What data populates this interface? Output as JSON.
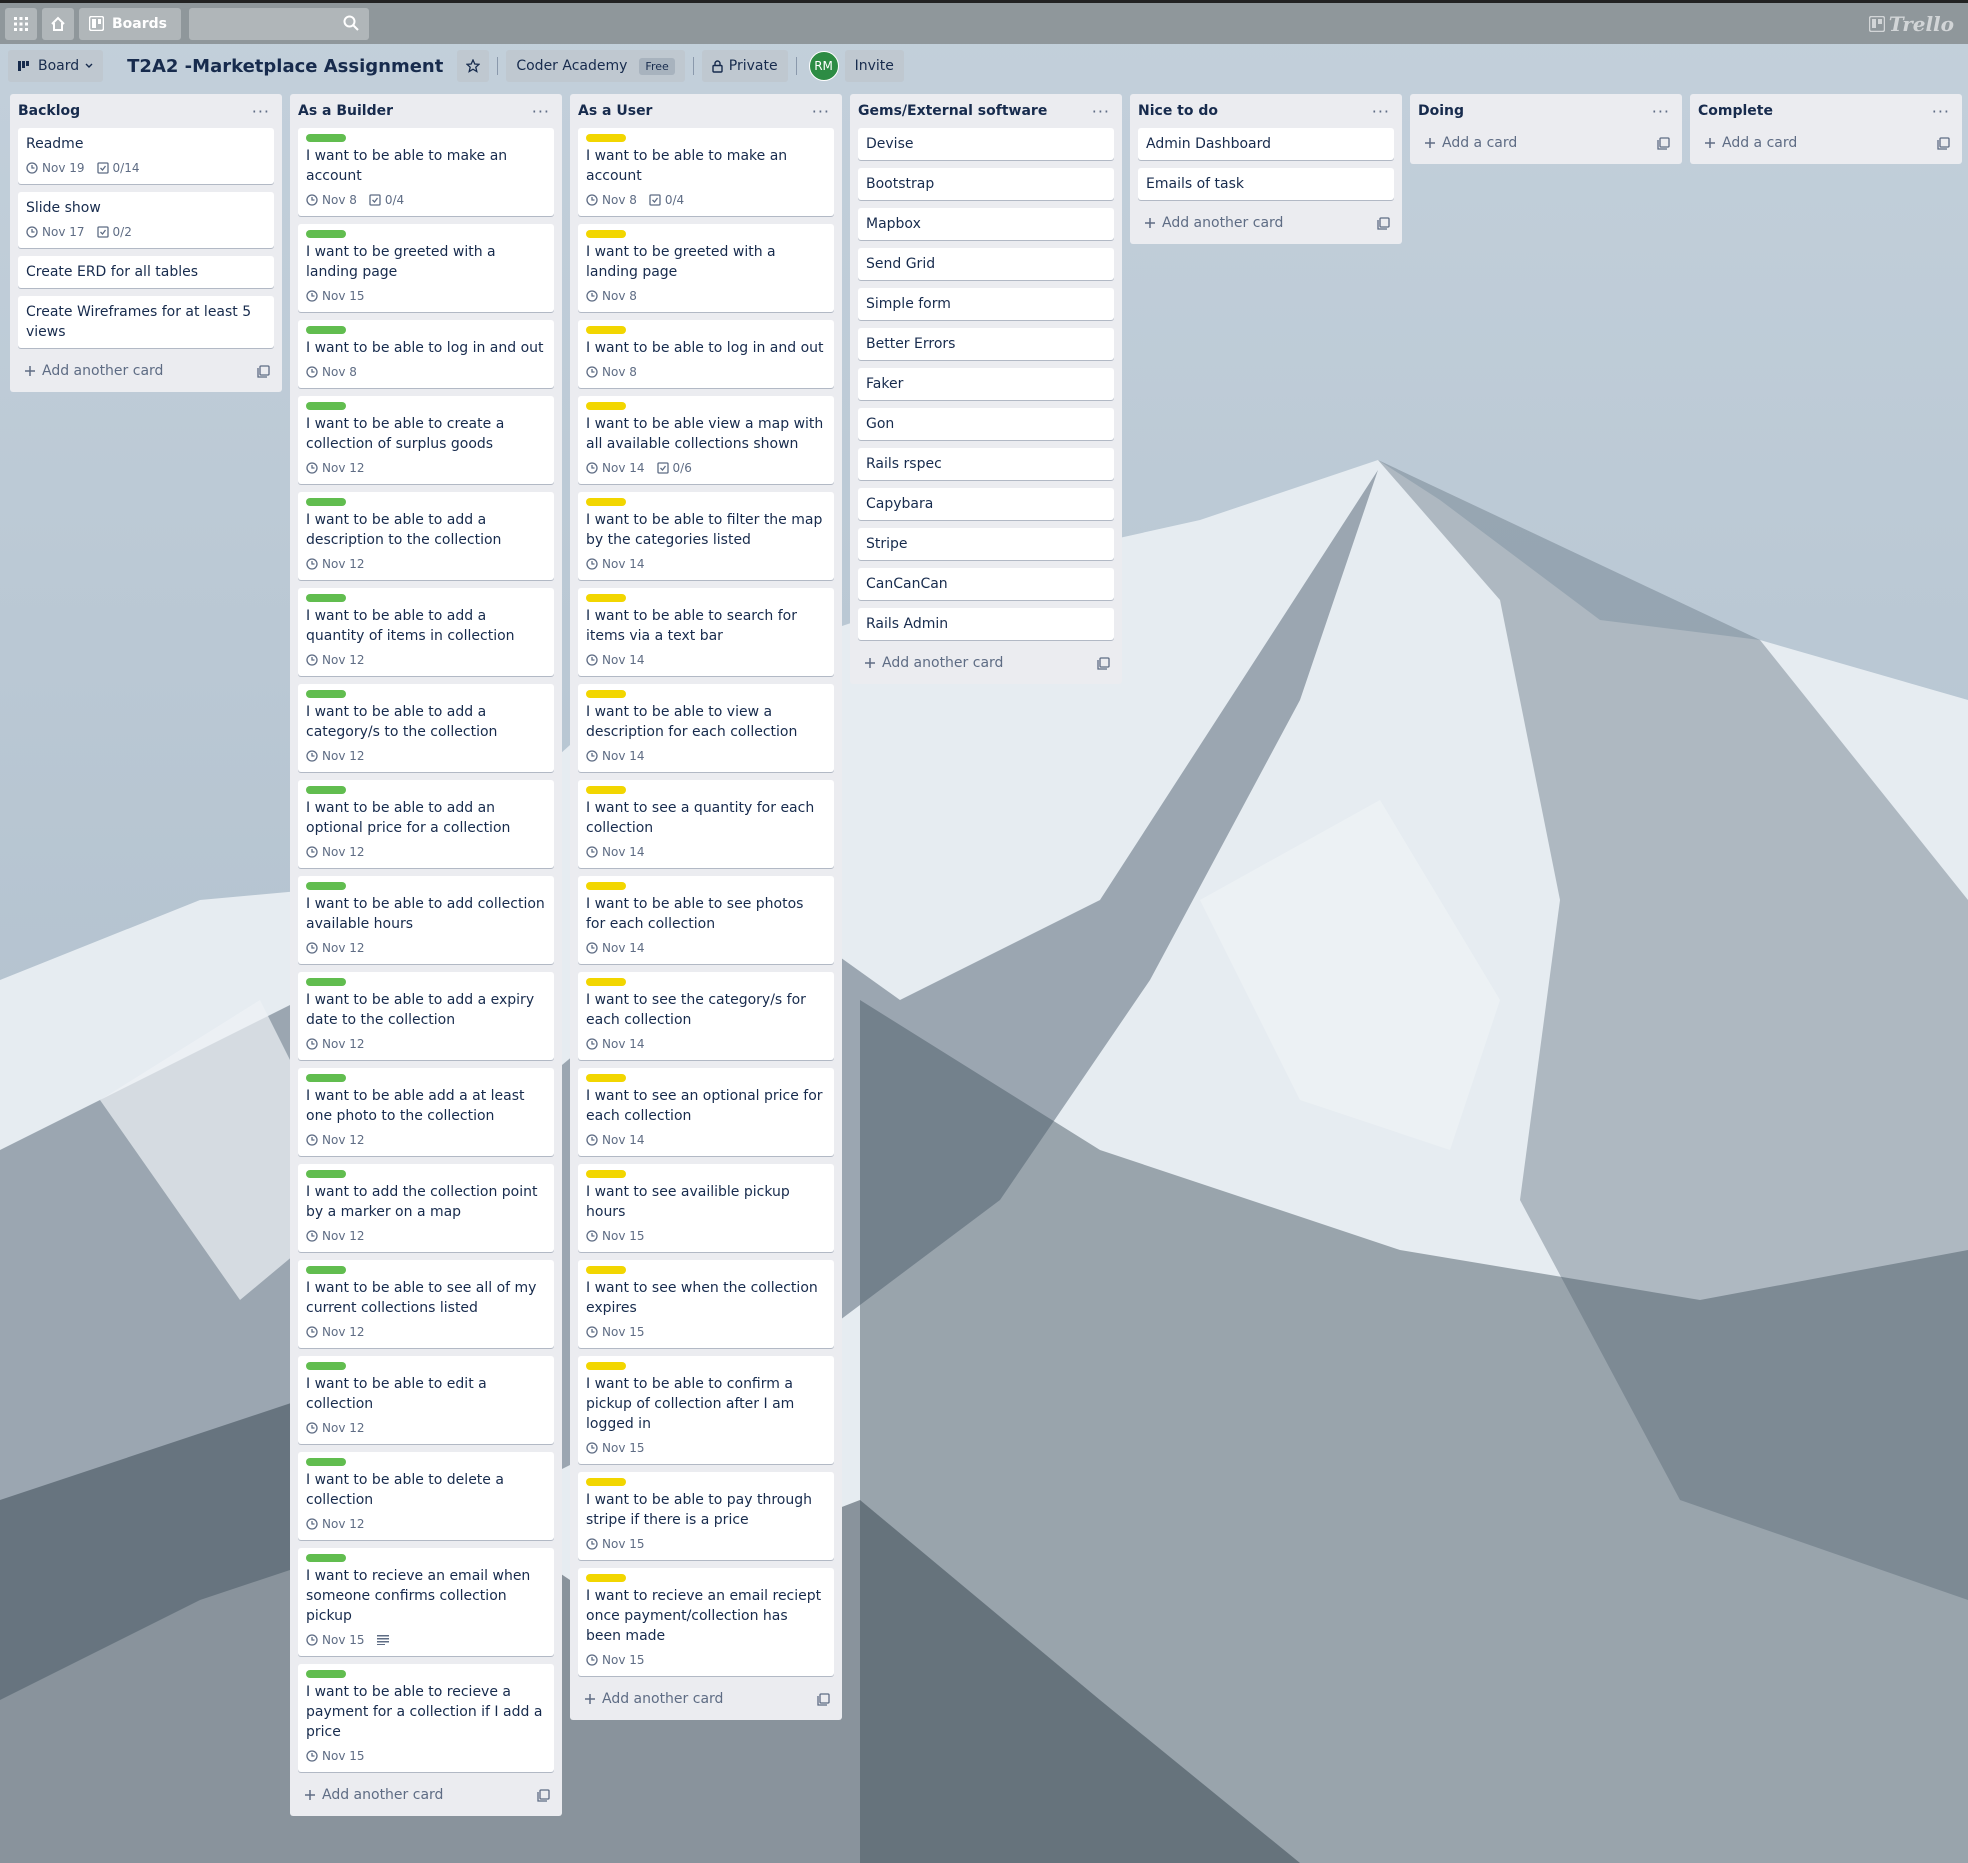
{
  "topbar": {
    "boards_label": "Boards",
    "logo": "Trello"
  },
  "board": {
    "view_label": "Board",
    "title": "T2A2 -Marketplace Assignment",
    "team": "Coder Academy",
    "plan": "Free",
    "visibility": "Private",
    "member_initials": "RM",
    "invite_label": "Invite"
  },
  "lists": [
    {
      "title": "Backlog",
      "add_label": "Add another card",
      "cards": [
        {
          "text": "Readme",
          "due": "Nov 19",
          "checklist": "0/14"
        },
        {
          "text": "Slide show",
          "due": "Nov 17",
          "checklist": "0/2"
        },
        {
          "text": "Create ERD for all tables"
        },
        {
          "text": "Create Wireframes for at least 5 views"
        }
      ]
    },
    {
      "title": "As a Builder",
      "add_label": "Add another card",
      "label_color": "green",
      "cards": [
        {
          "text": "I want to be able to make an account",
          "due": "Nov 8",
          "checklist": "0/4"
        },
        {
          "text": "I want to be greeted with a landing page",
          "due": "Nov 15"
        },
        {
          "text": "I want to be able to log in and out",
          "due": "Nov 8"
        },
        {
          "text": "I want to be able to create a collection of surplus goods",
          "due": "Nov 12"
        },
        {
          "text": "I want to be able to add a description to the collection",
          "due": "Nov 12"
        },
        {
          "text": "I want to be able to add a quantity of items in collection",
          "due": "Nov 12"
        },
        {
          "text": "I want to be able to add a category/s to the collection",
          "due": "Nov 12"
        },
        {
          "text": "I want to be able to add an optional price for a collection",
          "due": "Nov 12"
        },
        {
          "text": "I want to be able to add collection available hours",
          "due": "Nov 12"
        },
        {
          "text": "I want to be able to add a expiry date to the collection",
          "due": "Nov 12"
        },
        {
          "text": "I want to be able add a at least one photo to the collection",
          "due": "Nov 12"
        },
        {
          "text": "I want to add the collection point by a marker on a map",
          "due": "Nov 12"
        },
        {
          "text": "I want to be able to see all of my current collections listed",
          "due": "Nov 12"
        },
        {
          "text": "I want to be able to edit a collection",
          "due": "Nov 12"
        },
        {
          "text": "I want to be able to delete a collection",
          "due": "Nov 12"
        },
        {
          "text": "I want to recieve an email when someone confirms collection pickup",
          "due": "Nov 15",
          "description": true
        },
        {
          "text": "I want to be able to recieve a payment for a collection if I add a price",
          "due": "Nov 15"
        }
      ]
    },
    {
      "title": "As a User",
      "add_label": "Add another card",
      "label_color": "yellow",
      "cards": [
        {
          "text": "I want to be able to make an account",
          "due": "Nov 8",
          "checklist": "0/4"
        },
        {
          "text": "I want to be greeted with a landing page",
          "due": "Nov 8"
        },
        {
          "text": "I want to be able to log in and out",
          "due": "Nov 8"
        },
        {
          "text": "I want to be able view a map with all available collections shown",
          "due": "Nov 14",
          "checklist": "0/6"
        },
        {
          "text": "I want to be able to filter the map by the categories listed",
          "due": "Nov 14"
        },
        {
          "text": "I want to be able to search for items via a text bar",
          "due": "Nov 14"
        },
        {
          "text": "I want to be able to view a description for each collection",
          "due": "Nov 14"
        },
        {
          "text": "I want to see a quantity for each collection",
          "due": "Nov 14"
        },
        {
          "text": "I want to be able to see photos for each collection",
          "due": "Nov 14"
        },
        {
          "text": "I want to see the category/s for each collection",
          "due": "Nov 14"
        },
        {
          "text": "I want to see an optional price for each collection",
          "due": "Nov 14"
        },
        {
          "text": "I want to see availible pickup hours",
          "due": "Nov 15"
        },
        {
          "text": "I want to see when the collection expires",
          "due": "Nov 15"
        },
        {
          "text": "I want to be able to confirm a pickup of collection after I am logged in",
          "due": "Nov 15"
        },
        {
          "text": "I want to be able to pay through stripe if there is a price",
          "due": "Nov 15"
        },
        {
          "text": "I want to recieve an email reciept once payment/collection has been made",
          "due": "Nov 15"
        }
      ]
    },
    {
      "title": "Gems/External software",
      "add_label": "Add another card",
      "cards": [
        {
          "text": "Devise"
        },
        {
          "text": "Bootstrap"
        },
        {
          "text": "Mapbox"
        },
        {
          "text": "Send Grid"
        },
        {
          "text": "Simple form"
        },
        {
          "text": "Better Errors"
        },
        {
          "text": "Faker"
        },
        {
          "text": "Gon"
        },
        {
          "text": "Rails rspec"
        },
        {
          "text": "Capybara"
        },
        {
          "text": "Stripe"
        },
        {
          "text": "CanCanCan"
        },
        {
          "text": "Rails Admin"
        }
      ]
    },
    {
      "title": "Nice to do",
      "add_label": "Add another card",
      "cards": [
        {
          "text": "Admin Dashboard"
        },
        {
          "text": "Emails of task"
        }
      ]
    },
    {
      "title": "Doing",
      "add_label": "Add a card",
      "cards": []
    },
    {
      "title": "Complete",
      "add_label": "Add a card",
      "cards": []
    }
  ],
  "colors": {
    "green_label": "#61bd4f",
    "yellow_label": "#f2d600",
    "avatar": "#2d8c44",
    "list_bg": "#ebecf0",
    "header_bg": "#8f979b"
  },
  "icons": {
    "apps": "apps-grid-icon",
    "home": "home-icon",
    "boards": "boards-icon",
    "search": "search-icon",
    "star": "star-icon",
    "lock": "lock-icon",
    "clock": "clock-icon",
    "checklist": "checklist-icon",
    "description": "description-icon",
    "plus": "plus-icon",
    "template": "card-template-icon",
    "menu": "list-menu-icon"
  }
}
